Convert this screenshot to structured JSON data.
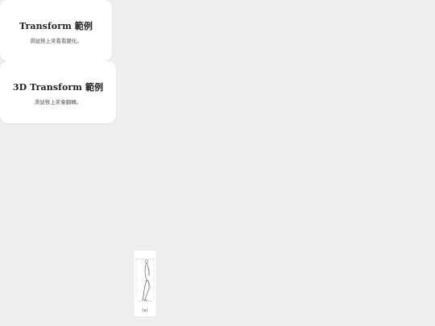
{
  "cards": [
    {
      "title": "Transform 範例",
      "subtitle": "滑鼠移上來看看變化。"
    },
    {
      "title": "3D Transform 範例",
      "subtitle": "滑鼠移上來會翻轉。"
    }
  ],
  "figure": {
    "caption": "(a)"
  },
  "colors": {
    "background": "#efefef",
    "card": "#ffffff",
    "title_text": "#222222",
    "body_text": "#555555"
  }
}
